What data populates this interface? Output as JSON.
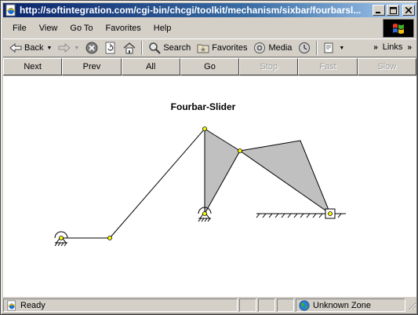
{
  "window": {
    "title": "http://softintegration.com/cgi-bin/chcgi/toolkit/mechanism/sixbar/fourbarsl..."
  },
  "menu": [
    "File",
    "View",
    "Go To",
    "Favorites",
    "Help"
  ],
  "toolbar": {
    "back": "Back",
    "search": "Search",
    "favorites": "Favorites",
    "media": "Media",
    "links": "Links"
  },
  "applet_buttons": [
    {
      "label": "Next",
      "enabled": true
    },
    {
      "label": "Prev",
      "enabled": true
    },
    {
      "label": "All",
      "enabled": true
    },
    {
      "label": "Go",
      "enabled": true
    },
    {
      "label": "Stop",
      "enabled": false
    },
    {
      "label": "Fast",
      "enabled": false
    },
    {
      "label": "Slow",
      "enabled": false
    }
  ],
  "mechanism": {
    "title": "Fourbar-Slider",
    "link_fill": "#c0c0c0",
    "joint_fill": "#ffff00"
  },
  "status": {
    "text": "Ready",
    "zone": "Unknown Zone"
  },
  "colors": {
    "title_bar_start": "#0a246a",
    "title_bar_end": "#a6caf0",
    "chrome": "#d4d0c8"
  }
}
